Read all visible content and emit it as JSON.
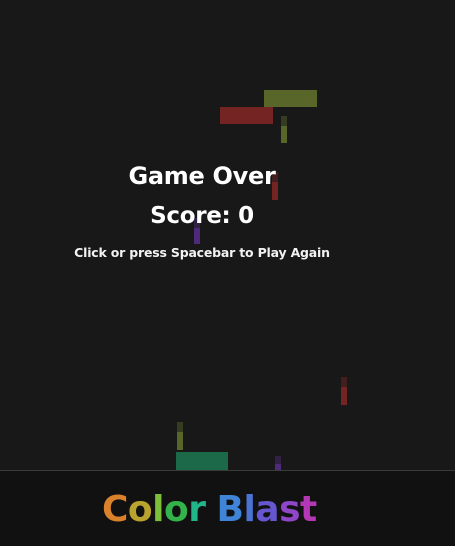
{
  "game_over": {
    "title": "Game Over",
    "score_text": "Score: 0",
    "hint": "Click or press Spacebar to Play Again"
  },
  "logo": {
    "text": "Color Blast",
    "letter_colors": [
      "#d9822b",
      "#b9a32f",
      "#7bbf3a",
      "#33b34a",
      "#21b589",
      "#3f84d6",
      "#4b73d4",
      "#6656cf",
      "#8f46c8",
      "#b437b5",
      "#d42a95"
    ]
  },
  "colors": {
    "background": "#181818",
    "footer": "#111111",
    "yellow_green": "#8fa83a",
    "red": "#c2302f",
    "teal": "#1fa06d",
    "purple": "#7c3bcc"
  }
}
